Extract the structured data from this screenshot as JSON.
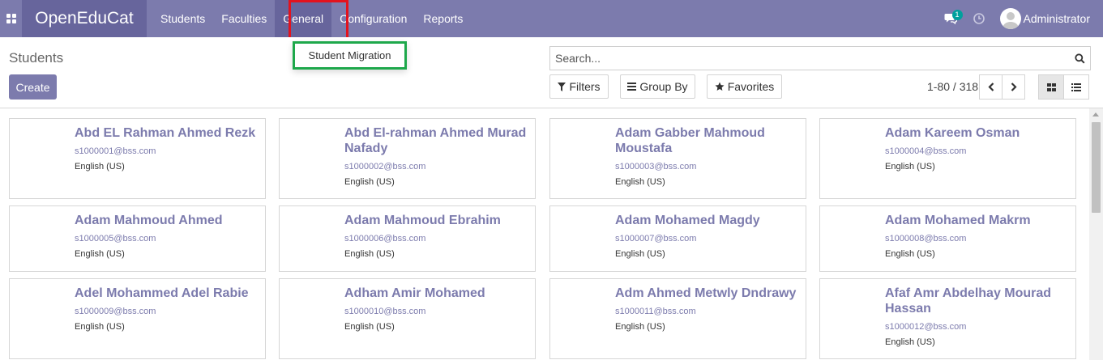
{
  "navbar": {
    "brand": "OpenEduCat",
    "menu": [
      "Students",
      "Faculties",
      "General",
      "Configuration",
      "Reports"
    ],
    "active_menu": "General",
    "chat_badge": "1",
    "user_name": "Administrator"
  },
  "dropdown": {
    "items": [
      "Student Migration"
    ]
  },
  "control": {
    "title": "Students",
    "create_label": "Create",
    "search_placeholder": "Search...",
    "filters_label": "Filters",
    "groupby_label": "Group By",
    "favorites_label": "Favorites",
    "pager": "1-80 / 318"
  },
  "students": [
    {
      "name": "Abd EL Rahman Ahmed Rezk",
      "email": "s1000001@bss.com",
      "lang": "English (US)"
    },
    {
      "name": "Abd El-rahman Ahmed Murad Nafady",
      "email": "s1000002@bss.com",
      "lang": "English (US)"
    },
    {
      "name": "Adam Gabber Mahmoud Moustafa",
      "email": "s1000003@bss.com",
      "lang": "English (US)"
    },
    {
      "name": "Adam Kareem Osman",
      "email": "s1000004@bss.com",
      "lang": "English (US)"
    },
    {
      "name": "Adam Mahmoud Ahmed",
      "email": "s1000005@bss.com",
      "lang": "English (US)"
    },
    {
      "name": "Adam Mahmoud Ebrahim",
      "email": "s1000006@bss.com",
      "lang": "English (US)"
    },
    {
      "name": "Adam Mohamed Magdy",
      "email": "s1000007@bss.com",
      "lang": "English (US)"
    },
    {
      "name": "Adam Mohamed Makrm",
      "email": "s1000008@bss.com",
      "lang": "English (US)"
    },
    {
      "name": "Adel Mohammed Adel Rabie",
      "email": "s1000009@bss.com",
      "lang": "English (US)"
    },
    {
      "name": "Adham Amir Mohamed",
      "email": "s1000010@bss.com",
      "lang": "English (US)"
    },
    {
      "name": "Adm Ahmed Metwly Dndrawy",
      "email": "s1000011@bss.com",
      "lang": "English (US)"
    },
    {
      "name": "Afaf Amr Abdelhay Mourad Hassan",
      "email": "s1000012@bss.com",
      "lang": "English (US)"
    }
  ],
  "colors": {
    "navbar": "#7c7bad",
    "brand_bg": "#67659c",
    "highlight_red": "#e3131e",
    "highlight_green": "#1ea84b"
  }
}
